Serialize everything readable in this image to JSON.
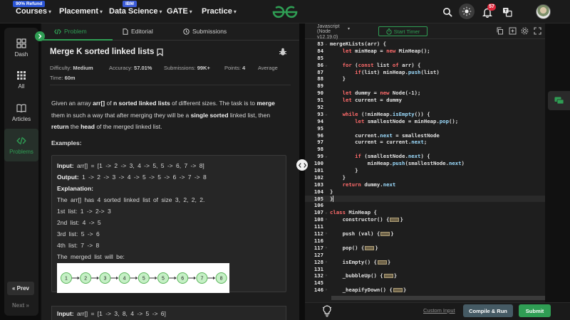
{
  "nav": {
    "courses": {
      "label": "Courses",
      "badge": "90% Refund"
    },
    "placement": "Placement",
    "data_science": {
      "label": "Data Science",
      "badge": "IBM"
    },
    "gate": "GATE",
    "practice": "Practice",
    "notification_count": "57"
  },
  "sidebar": {
    "items": [
      {
        "label": "Dash",
        "icon": "dashboard-icon"
      },
      {
        "label": "All",
        "icon": "grid-icon"
      },
      {
        "label": "Articles",
        "icon": "book-icon"
      },
      {
        "label": "Problems",
        "icon": "code-icon"
      }
    ],
    "prev": "« Prev",
    "next": "Next »"
  },
  "problem_tabs": [
    "Problem",
    "Editorial",
    "Submissions"
  ],
  "problem": {
    "title": "Merge K sorted linked lists",
    "difficulty_label": "Difficulty:",
    "difficulty": "Medium",
    "accuracy_label": "Accuracy:",
    "accuracy": "57.01%",
    "submissions_label": "Submissions:",
    "submissions": "99K+",
    "points_label": "Points:",
    "points": "4",
    "avg_time_label": "Average",
    "time_label": "Time:",
    "time": "60m",
    "desc": {
      "p1": "Given an array ",
      "arr": "arr[]",
      "p2": " of ",
      "n_sorted": "n sorted linked lists",
      "p3": " of different sizes. The task is to ",
      "merge": "merge",
      "p4": " them in such a way that after merging they will be a ",
      "single_sorted": "single sorted",
      "p5": " linked list, then ",
      "return": "return",
      "p6": " the ",
      "head": "head",
      "p7": " of the merged linked list."
    },
    "examples_heading": "Examples:",
    "example1": {
      "input_label": "Input:",
      "input": " arr[] = [1 -> 2 -> 3, 4 -> 5, 5 -> 6, 7 -> 8]",
      "output_label": "Output:",
      "output": " 1 -> 2 -> 3 -> 4 -> 5 -> 5 -> 6 -> 7 -> 8",
      "explanation_label": "Explanation:",
      "lines": [
        "The arr[] has 4 sorted linked list of size 3, 2, 2, 2.",
        "1st list: 1 -> 2-> 3",
        "2nd list: 4 -> 5",
        "3rd list: 5 -> 6",
        "4th list: 7 -> 8",
        "The merged list will be:"
      ],
      "merged_nodes": [
        "1",
        "2",
        "3",
        "4",
        "5",
        "5",
        "6",
        "7",
        "8"
      ]
    },
    "example2": {
      "input_label": "Input:",
      "input": " arr[] = [1 -> 3, 8, 4 -> 5 -> 6]"
    }
  },
  "editor": {
    "language_line1": "Javascript",
    "language_line2": "(Node",
    "language_line3": "v12.19.0)",
    "start_timer": "Start Timer",
    "lines": [
      {
        "n": "83",
        "text": "merge<K>Lists(arr) {"
      },
      {
        "n": "84",
        "text": "    let minHeap = new MinHeap();"
      },
      {
        "n": "85",
        "text": ""
      },
      {
        "n": "86",
        "text": "    for (const list of arr) {"
      },
      {
        "n": "87",
        "text": "        if(list) minHeap.push(list)"
      },
      {
        "n": "88",
        "text": "    }"
      },
      {
        "n": "89",
        "text": ""
      },
      {
        "n": "90",
        "text": "    let dummy = new Node(-1);"
      },
      {
        "n": "91",
        "text": "    let current = dummy"
      },
      {
        "n": "92",
        "text": ""
      },
      {
        "n": "93",
        "text": "    while (!minHeap.isEmpty()) {"
      },
      {
        "n": "94",
        "text": "        let smallestNode = minHeap.pop();"
      },
      {
        "n": "95",
        "text": ""
      },
      {
        "n": "96",
        "text": "        current.next = smallestNode"
      },
      {
        "n": "97",
        "text": "        current = current.next;"
      },
      {
        "n": "98",
        "text": ""
      },
      {
        "n": "99",
        "text": "        if (smallestNode.next) {"
      },
      {
        "n": "100",
        "text": "            minHeap.push(smallestNode.next)"
      },
      {
        "n": "101",
        "text": "        }"
      },
      {
        "n": "102",
        "text": "    }"
      },
      {
        "n": "103",
        "text": "    return dummy.next"
      },
      {
        "n": "104",
        "text": "}"
      },
      {
        "n": "105",
        "text": "}"
      },
      {
        "n": "106",
        "text": ""
      },
      {
        "n": "107",
        "text": "class MinHeap {"
      },
      {
        "n": "108",
        "text": "    constructor() {"
      },
      {
        "n": "111",
        "text": ""
      },
      {
        "n": "112",
        "text": "    push (val) {"
      },
      {
        "n": "116",
        "text": ""
      },
      {
        "n": "117",
        "text": "    pop() {"
      },
      {
        "n": "127",
        "text": ""
      },
      {
        "n": "128",
        "text": "    isEmpty() {"
      },
      {
        "n": "131",
        "text": ""
      },
      {
        "n": "132",
        "text": "    _bubbleUp() {"
      },
      {
        "n": "145",
        "text": ""
      },
      {
        "n": "146",
        "text": "    _heapifyDown() {"
      }
    ]
  },
  "bottom": {
    "custom_input": "Custom Input",
    "compile_run": "Compile & Run",
    "submit": "Submit"
  },
  "colors": {
    "accent": "#2f9e54",
    "run_button": "#455a64",
    "notification": "#e0283c",
    "keyword": "#ff6b6b"
  }
}
